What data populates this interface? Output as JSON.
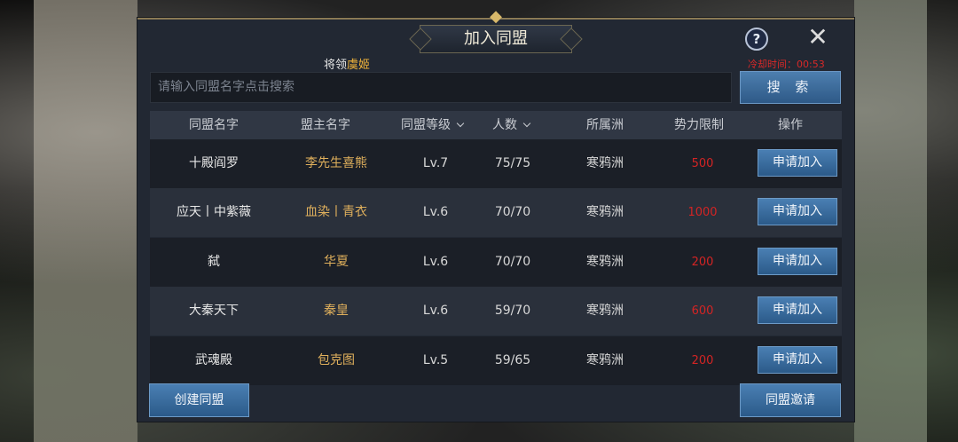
{
  "dialog": {
    "title": "加入同盟",
    "help_label": "?",
    "close_label": "✕",
    "ticker_prefix": "将领",
    "ticker_highlight": "虞姬",
    "cooldown": "冷却时间：00:53"
  },
  "search": {
    "placeholder": "请输入同盟名字点击搜索",
    "button_label": "搜 索"
  },
  "table": {
    "columns": [
      "同盟名字",
      "盟主名字",
      "同盟等级",
      "人数",
      "所属洲",
      "势力限制",
      "操作"
    ],
    "rows": [
      {
        "name": "十殿阎罗",
        "leader": "李先生喜熊",
        "level": "Lv.7",
        "members": "75/75",
        "region": "寒鸦洲",
        "limit": "500",
        "action": "申请加入"
      },
      {
        "name": "应天丨中紫薇",
        "leader": "血染丨青衣",
        "level": "Lv.6",
        "members": "70/70",
        "region": "寒鸦洲",
        "limit": "1000",
        "action": "申请加入"
      },
      {
        "name": "弑",
        "leader": "华夏",
        "level": "Lv.6",
        "members": "70/70",
        "region": "寒鸦洲",
        "limit": "200",
        "action": "申请加入"
      },
      {
        "name": "大秦天下",
        "leader": "秦皇",
        "level": "Lv.6",
        "members": "59/70",
        "region": "寒鸦洲",
        "limit": "600",
        "action": "申请加入"
      },
      {
        "name": "武魂殿",
        "leader": "包克图",
        "level": "Lv.5",
        "members": "59/65",
        "region": "寒鸦洲",
        "limit": "200",
        "action": "申请加入"
      }
    ]
  },
  "footer": {
    "create_label": "创建同盟",
    "invite_label": "同盟邀请"
  },
  "colors": {
    "panel": "#222833",
    "button": "#3b6b9b",
    "leader_text": "#e0b05c",
    "limit_text": "#d42424",
    "cooldown_text": "#d82828"
  }
}
